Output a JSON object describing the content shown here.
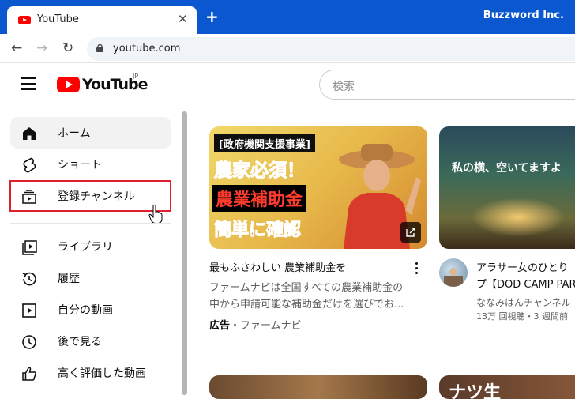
{
  "browser": {
    "tab_title": "YouTube",
    "tab_close": "✕",
    "new_tab": "+",
    "profile_name": "Buzzword Inc.",
    "url": "youtube.com"
  },
  "masthead": {
    "logo_text": "YouTube",
    "region": "JP",
    "search_placeholder": "検索"
  },
  "sidebar": {
    "items": [
      {
        "label": "ホーム",
        "icon": "home-icon",
        "active": true
      },
      {
        "label": "ショート",
        "icon": "shorts-icon"
      },
      {
        "label": "登録チャンネル",
        "icon": "subscriptions-icon",
        "highlighted": true
      },
      {
        "label": "ライブラリ",
        "icon": "library-icon"
      },
      {
        "label": "履歴",
        "icon": "history-icon"
      },
      {
        "label": "自分の動画",
        "icon": "your-videos-icon"
      },
      {
        "label": "後で見る",
        "icon": "watch-later-icon"
      },
      {
        "label": "高く評価した動画",
        "icon": "liked-videos-icon"
      }
    ]
  },
  "videos": [
    {
      "thumb_tag": "[政府機関支援事業]",
      "thumb_line1": "農家必須！",
      "thumb_line2": "農業補助金",
      "thumb_line3": "簡単に確認",
      "title": "最もふさわしい 農業補助金を",
      "desc_line1": "ファームナビは全国すべての農業補助金の",
      "desc_line2": "中から申請可能な補助金だけを選びでお...",
      "ad_label": "広告",
      "separator": "・",
      "channel": "ファームナビ"
    },
    {
      "thumb_text": "私の横、空いてますよ",
      "title_line1": "アラサー女のひとり",
      "title_line2": "プ【DOD CAMP PAR",
      "channel": "ななみはんチャンネル",
      "stats": "13万 回視聴・3 週間前"
    },
    {
      "thumb_text": "ナツ生"
    }
  ],
  "colors": {
    "chrome_blue": "#0b57d0",
    "youtube_red": "#ff0000",
    "highlight_red": "#e0202c"
  }
}
